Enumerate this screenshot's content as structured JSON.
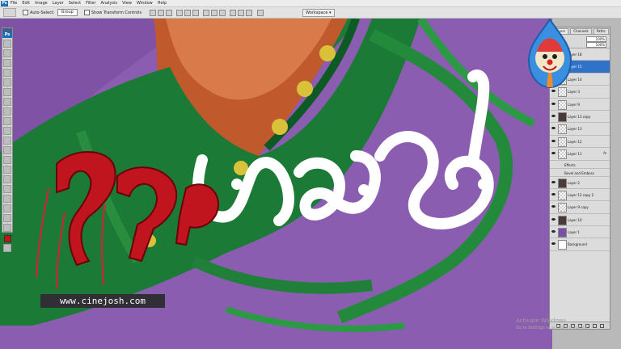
{
  "menubar": {
    "app_badge": "Ps",
    "items": [
      "File",
      "Edit",
      "Image",
      "Layer",
      "Select",
      "Filter",
      "Analysis",
      "View",
      "Window",
      "Help"
    ]
  },
  "options": {
    "auto_select_label": "Auto-Select:",
    "auto_select_value": "Group",
    "show_transform_label": "Show Transform Controls",
    "workspace_label": "Workspace ▾"
  },
  "toolbox": {
    "badge": "Ps",
    "foreground_color": "#c41414"
  },
  "canvas": {
    "background_color": "#8a5db0",
    "watermark": "www.cinejosh.com"
  },
  "layers_panel": {
    "tabs": [
      "Layers",
      "Channels",
      "Paths"
    ],
    "opacity_label": "100%",
    "fill_label": "100%",
    "layers": [
      {
        "label": "Layer 18",
        "thumb": "trans"
      },
      {
        "label": "Layer 15",
        "thumb": "trans",
        "selected": true
      },
      {
        "label": "Layer 14",
        "thumb": "trans"
      },
      {
        "label": "Layer 3",
        "thumb": "trans"
      },
      {
        "label": "Layer 9",
        "thumb": "trans"
      },
      {
        "label": "Layer 13 copy",
        "thumb": "dark"
      },
      {
        "label": "Layer 13",
        "thumb": "trans"
      },
      {
        "label": "Layer 12",
        "thumb": "trans"
      },
      {
        "label": "Layer 11",
        "thumb": "trans",
        "fx": "fx"
      },
      {
        "label": "Effects",
        "sub": true
      },
      {
        "label": "Bevel and Emboss",
        "sub": true
      },
      {
        "label": "Layer 2",
        "thumb": "dark"
      },
      {
        "label": "Layer 12 copy 2",
        "thumb": "trans"
      },
      {
        "label": "Layer 9 copy",
        "thumb": "trans"
      },
      {
        "label": "Layer 10",
        "thumb": "dark"
      },
      {
        "label": "Layer 1",
        "thumb": "purple"
      },
      {
        "label": "Background",
        "thumb": "white"
      }
    ]
  },
  "system_overlay": {
    "line1": "Activate Windows",
    "line2": "Go to Settings to activate Windows."
  },
  "colors": {
    "accent": "#2f72c8",
    "toolbar": "#e3e3e3",
    "panel": "#dcdcdc"
  }
}
